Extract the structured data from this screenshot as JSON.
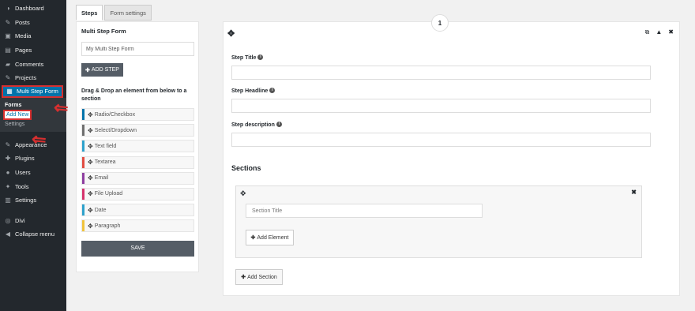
{
  "sidebar": {
    "items": [
      {
        "label": "Dashboard",
        "icon": "dashboard-icon",
        "glyph": "◑"
      },
      {
        "label": "Posts",
        "icon": "pin-icon",
        "glyph": "✎"
      },
      {
        "label": "Media",
        "icon": "media-icon",
        "glyph": "▣"
      },
      {
        "label": "Pages",
        "icon": "page-icon",
        "glyph": "▤"
      },
      {
        "label": "Comments",
        "icon": "comment-icon",
        "glyph": "▰"
      },
      {
        "label": "Projects",
        "icon": "pin-icon",
        "glyph": "✎"
      },
      {
        "label": "Multi Step Form",
        "icon": "form-icon",
        "glyph": "▦"
      }
    ],
    "submenu": {
      "head": "Forms",
      "add_new": "Add New",
      "settings": "Settings"
    },
    "items2": [
      {
        "label": "Appearance",
        "glyph": "✎"
      },
      {
        "label": "Plugins",
        "glyph": "✚"
      },
      {
        "label": "Users",
        "glyph": "●"
      },
      {
        "label": "Tools",
        "glyph": "✦"
      },
      {
        "label": "Settings",
        "glyph": "▥"
      }
    ],
    "items3": [
      {
        "label": "Divi",
        "glyph": "◎"
      },
      {
        "label": "Collapse menu",
        "glyph": "◀"
      }
    ]
  },
  "tabs": [
    {
      "label": "Steps"
    },
    {
      "label": "Form settings"
    }
  ],
  "left_panel": {
    "title": "Multi Step Form",
    "form_name_value": "My Multi Step Form",
    "add_step_label": "ADD STEP",
    "dd_text": "Drag & Drop an element from below to a section",
    "elements": [
      {
        "label": "Radio/Checkbox",
        "color": "#0073aa"
      },
      {
        "label": "Select/Dropdown",
        "color": "#6f6f6f"
      },
      {
        "label": "Text field",
        "color": "#2ea2cc"
      },
      {
        "label": "Textarea",
        "color": "#e14d43"
      },
      {
        "label": "Email",
        "color": "#8e3fa0"
      },
      {
        "label": "File Upload",
        "color": "#d6336c"
      },
      {
        "label": "Date",
        "color": "#2ea2cc"
      },
      {
        "label": "Paragraph",
        "color": "#f0c33c"
      }
    ],
    "save_label": "SAVE"
  },
  "main": {
    "step_number": "1",
    "step_title_label": "Step Title",
    "step_headline_label": "Step Headline",
    "step_description_label": "Step description",
    "sections_heading": "Sections",
    "section_title_placeholder": "Section Title",
    "add_element_label": "Add Element",
    "add_section_label": "Add Section"
  }
}
